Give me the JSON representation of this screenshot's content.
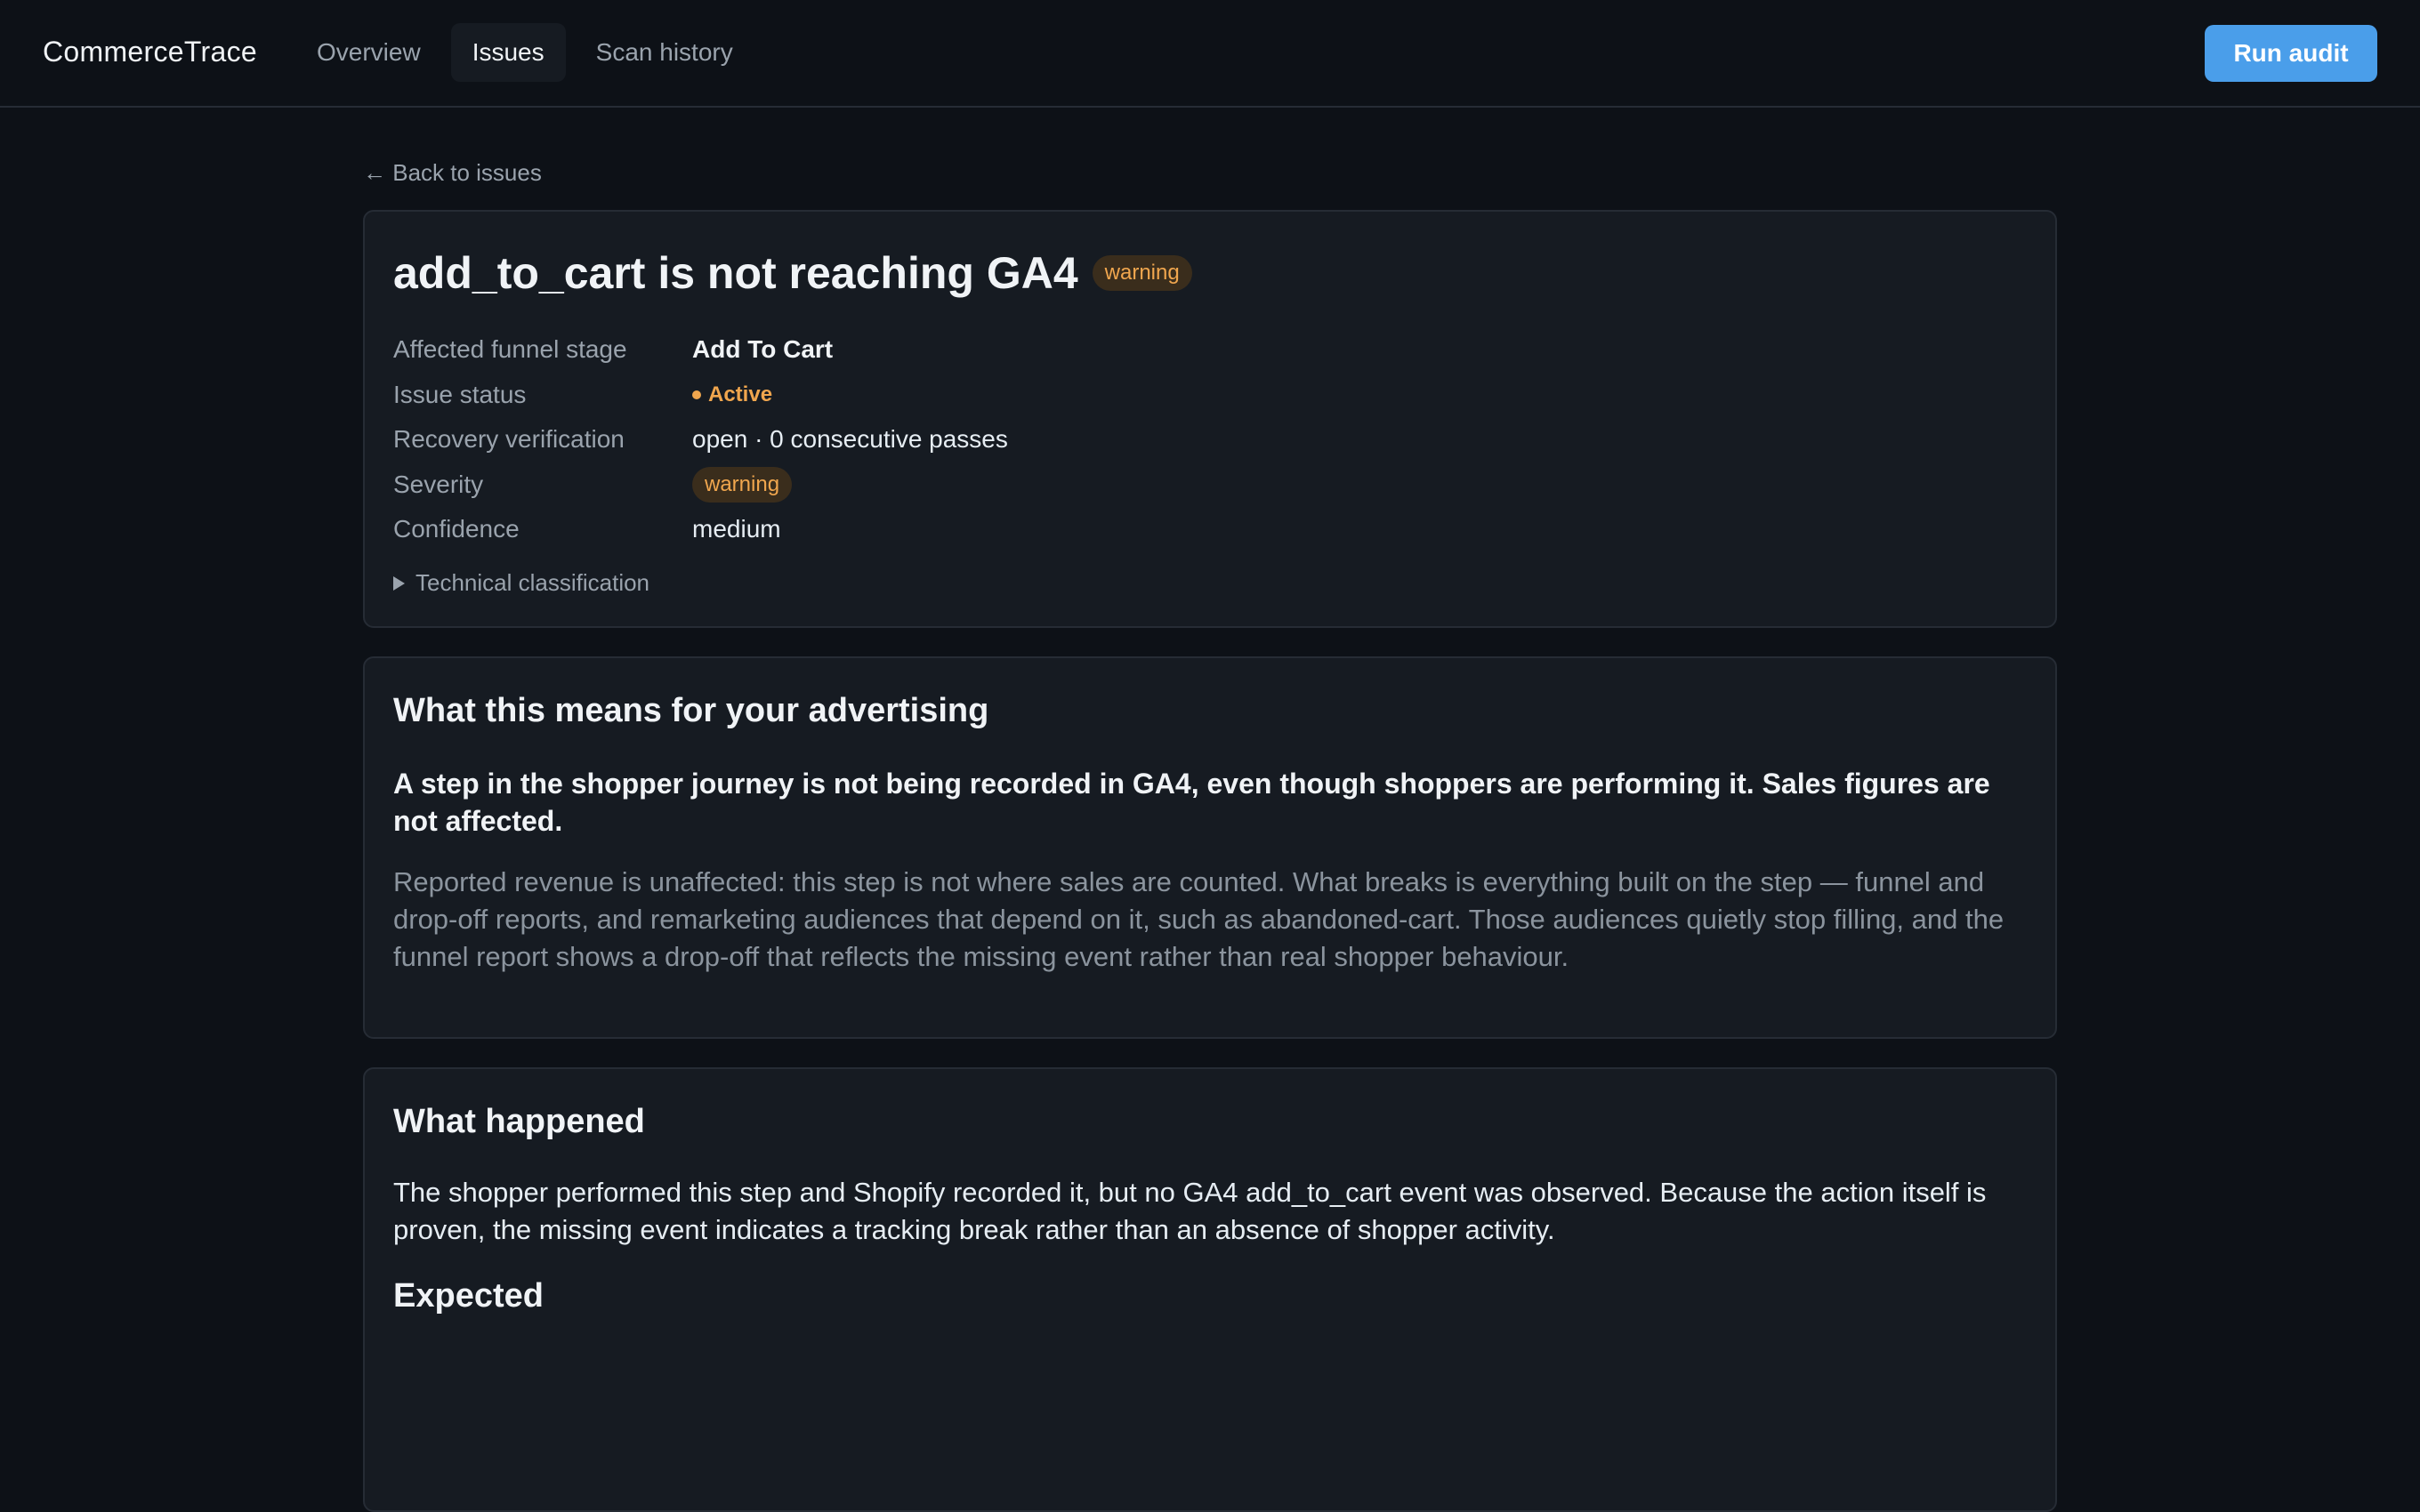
{
  "app": {
    "brand": "CommerceTrace"
  },
  "nav": {
    "tabs": [
      {
        "label": "Overview",
        "active": false
      },
      {
        "label": "Issues",
        "active": true
      },
      {
        "label": "Scan history",
        "active": false
      }
    ],
    "run_audit_label": "Run audit"
  },
  "back_link": "← Back to issues",
  "issue": {
    "title": "add_to_cart is not reaching GA4",
    "severity_badge": "warning",
    "fields": {
      "funnel_stage_label": "Affected funnel stage",
      "funnel_stage_value": "Add To Cart",
      "status_label": "Issue status",
      "status_value": "Active",
      "recovery_label": "Recovery verification",
      "recovery_value": "open · 0 consecutive passes",
      "severity_label": "Severity",
      "severity_value": "warning",
      "confidence_label": "Confidence",
      "confidence_value": "medium"
    },
    "tech_toggle_label": "Technical classification"
  },
  "meaning": {
    "title": "What this means for your advertising",
    "lead": "A step in the shopper journey is not being recorded in GA4, even though shoppers are performing it. Sales figures are not affected.",
    "detail": "Reported revenue is unaffected: this step is not where sales are counted. What breaks is everything built on the step — funnel and drop-off reports, and remarketing audiences that depend on it, such as abandoned-cart. Those audiences quietly stop filling, and the funnel report shows a drop-off that reflects the missing event rather than real shopper behaviour."
  },
  "happened": {
    "title": "What happened",
    "body": "The shopper performed this step and Shopify recorded it, but no GA4 add_to_cart event was observed. Because the action itself is proven, the missing event indicates a tracking break rather than an absence of shopper activity.",
    "expected_title": "Expected"
  },
  "colors": {
    "background": "#0d1117",
    "card": "#161b22",
    "accent": "#4a9eea",
    "warning": "#f0a64e"
  }
}
